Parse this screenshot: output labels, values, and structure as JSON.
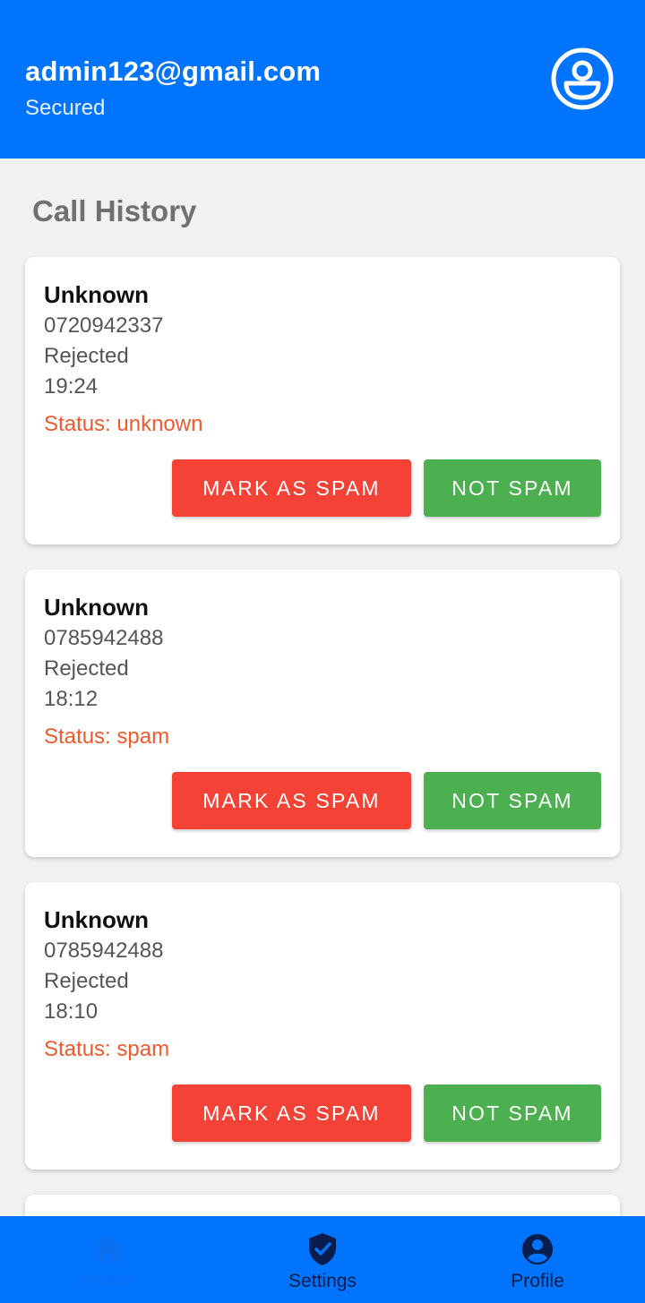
{
  "header": {
    "email": "admin123@gmail.com",
    "subtitle": "Secured",
    "avatar_icon": "account-circle-icon"
  },
  "section_title": "Call History",
  "calls": [
    {
      "name": "Unknown",
      "number": "0720942337",
      "type": "Rejected",
      "time": "19:24",
      "status": "Status: unknown",
      "mark_spam_label": "MARK AS SPAM",
      "not_spam_label": "NOT SPAM"
    },
    {
      "name": "Unknown",
      "number": "0785942488",
      "type": "Rejected",
      "time": "18:12",
      "status": "Status: spam",
      "mark_spam_label": "MARK AS SPAM",
      "not_spam_label": "NOT SPAM"
    },
    {
      "name": "Unknown",
      "number": "0785942488",
      "type": "Rejected",
      "time": "18:10",
      "status": "Status: spam",
      "mark_spam_label": "MARK AS SPAM",
      "not_spam_label": "NOT SPAM"
    }
  ],
  "bottom_nav": {
    "items": [
      {
        "label": "Home",
        "icon": "home-icon",
        "active": true
      },
      {
        "label": "Settings",
        "icon": "shield-check-icon",
        "active": false
      },
      {
        "label": "Profile",
        "icon": "account-circle-icon",
        "active": false
      }
    ]
  },
  "colors": {
    "primary": "#0074fd",
    "spam_button": "#f44336",
    "not_spam_button": "#4caf50",
    "status_text": "#f05a2c",
    "background": "#f1f1f1"
  }
}
